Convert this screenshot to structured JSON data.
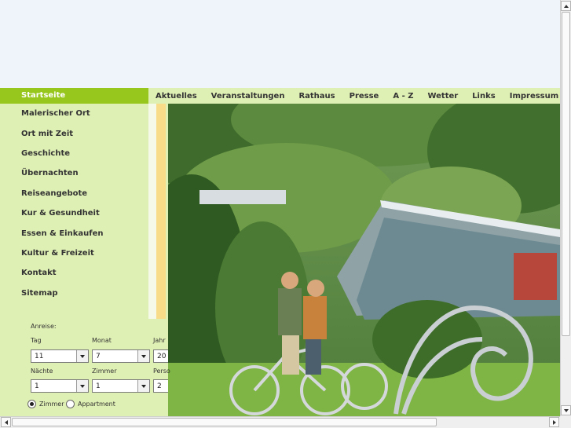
{
  "topnav": {
    "start": "Startseite",
    "items": [
      "Aktuelles",
      "Veranstaltungen",
      "Rathaus",
      "Presse",
      "A - Z",
      "Wetter",
      "Links",
      "Impressum"
    ]
  },
  "sidebar": {
    "items": [
      "Malerischer Ort",
      "Ort mit Zeit",
      "Geschichte",
      "Übernachten",
      "Reiseangebote",
      "Kur & Gesundheit",
      "Essen & Einkaufen",
      "Kultur & Freizeit",
      "Kontakt",
      "Sitemap"
    ]
  },
  "booking": {
    "title": "Anreise:",
    "tag_label": "Tag",
    "monat_label": "Monat",
    "jahr_label": "Jahr",
    "tag_value": "11",
    "monat_value": "7",
    "jahr_value": "20",
    "naechte_label": "Nächte",
    "zimmer_label": "Zimmer",
    "personen_label": "Perso",
    "naechte_value": "1",
    "zimmer_value": "1",
    "personen_value": "2",
    "radio_zimmer": "Zimmer",
    "radio_appartment": "Appartment"
  },
  "colors": {
    "accent_green": "#97c61c",
    "light_green": "#dff0b4",
    "banner": "#eef4fa",
    "stripe_yellow": "#f8dc87"
  }
}
